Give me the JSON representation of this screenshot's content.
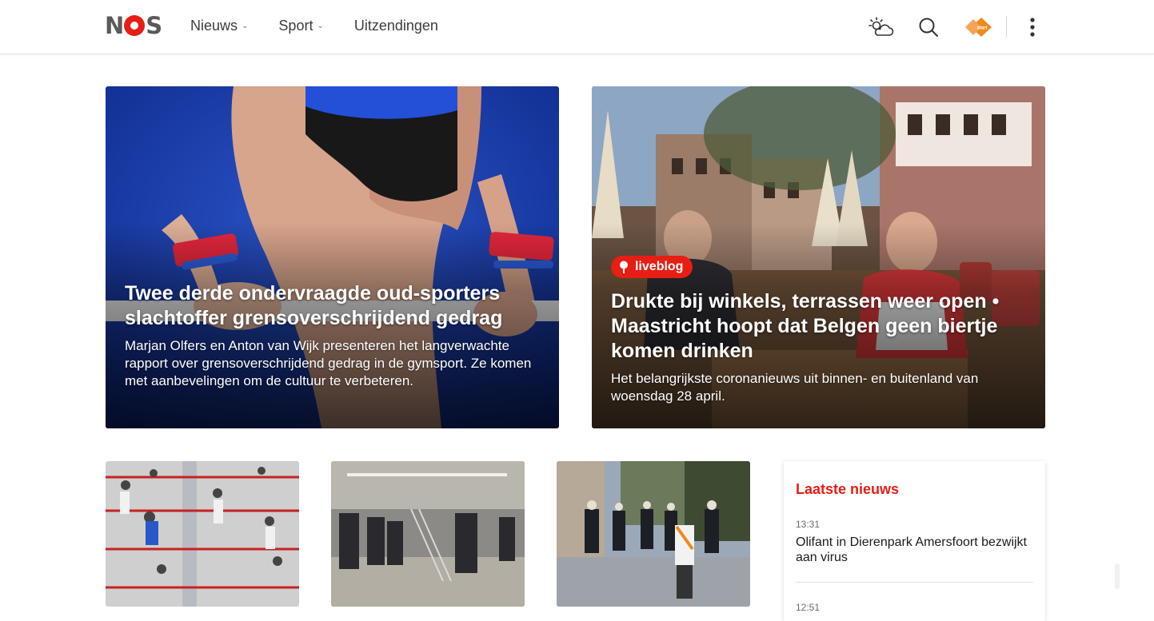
{
  "header": {
    "logo_text": "NOS",
    "nav": [
      {
        "label": "Nieuws",
        "has_dropdown": true
      },
      {
        "label": "Sport",
        "has_dropdown": true
      },
      {
        "label": "Uitzendingen",
        "has_dropdown": false
      }
    ],
    "icons": [
      "weather-icon",
      "search-icon",
      "npo-start-icon",
      "more-menu-icon"
    ]
  },
  "hero": [
    {
      "title": "Twee derde ondervraagde oud-sporters slachtoffer grensoverschrijdend gedrag",
      "summary": "Marjan Olfers en Anton van Wijk presenteren het langverwachte rapport over grensoverschrijdend gedrag in de gymsport. Ze komen met aanbevelingen om de cultuur te verbeteren."
    },
    {
      "badge": "liveblog",
      "title": "Drukte bij winkels, terrassen weer open • Maastricht hoopt dat Belgen geen biertje komen drinken",
      "summary": "Het belangrijkste coronanieuws uit binnen- en buitenland van woensdag 28 april."
    }
  ],
  "latest": {
    "heading": "Laatste nieuws",
    "items": [
      {
        "time": "13:31",
        "title": "Olifant in Dierenpark Amersfoort bezwijkt aan virus"
      },
      {
        "time": "12:51",
        "title": ""
      }
    ]
  },
  "colors": {
    "brand_red": "#e61e14",
    "text": "#1b1b1b",
    "nav_text": "#3d3d3d"
  }
}
